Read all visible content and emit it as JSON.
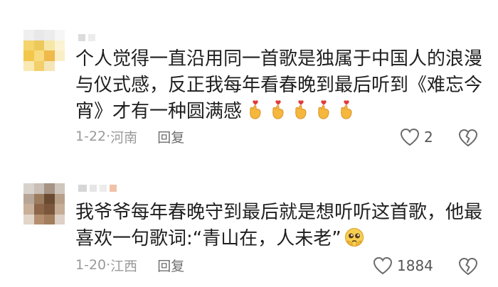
{
  "comments": [
    {
      "text": "个人觉得一直沿用同一首歌是独属于中国人的浪漫与仪式感，反正我每年看春晚到最后听到《难忘今宵》才有一种圆满感",
      "emoji": [
        "finger-heart-icon",
        "finger-heart-icon",
        "finger-heart-icon",
        "finger-heart-icon",
        "finger-heart-icon"
      ],
      "date": "1-22",
      "location": "河南",
      "reply_label": "回复",
      "likes": "2"
    },
    {
      "text": "我爷爷每年春晚守到最后就是想听听这首歌，他最喜欢一句歌词:“青山在，人未老”",
      "emoji": [
        "pleading-face-icon"
      ],
      "date": "1-20",
      "location": "江西",
      "reply_label": "回复",
      "likes": "1884"
    }
  ],
  "colors": {
    "text": "#1f1f1f",
    "meta": "#9a9a9a",
    "heart": "#e23b3b",
    "emoji_yellow": "#f5b83d"
  }
}
